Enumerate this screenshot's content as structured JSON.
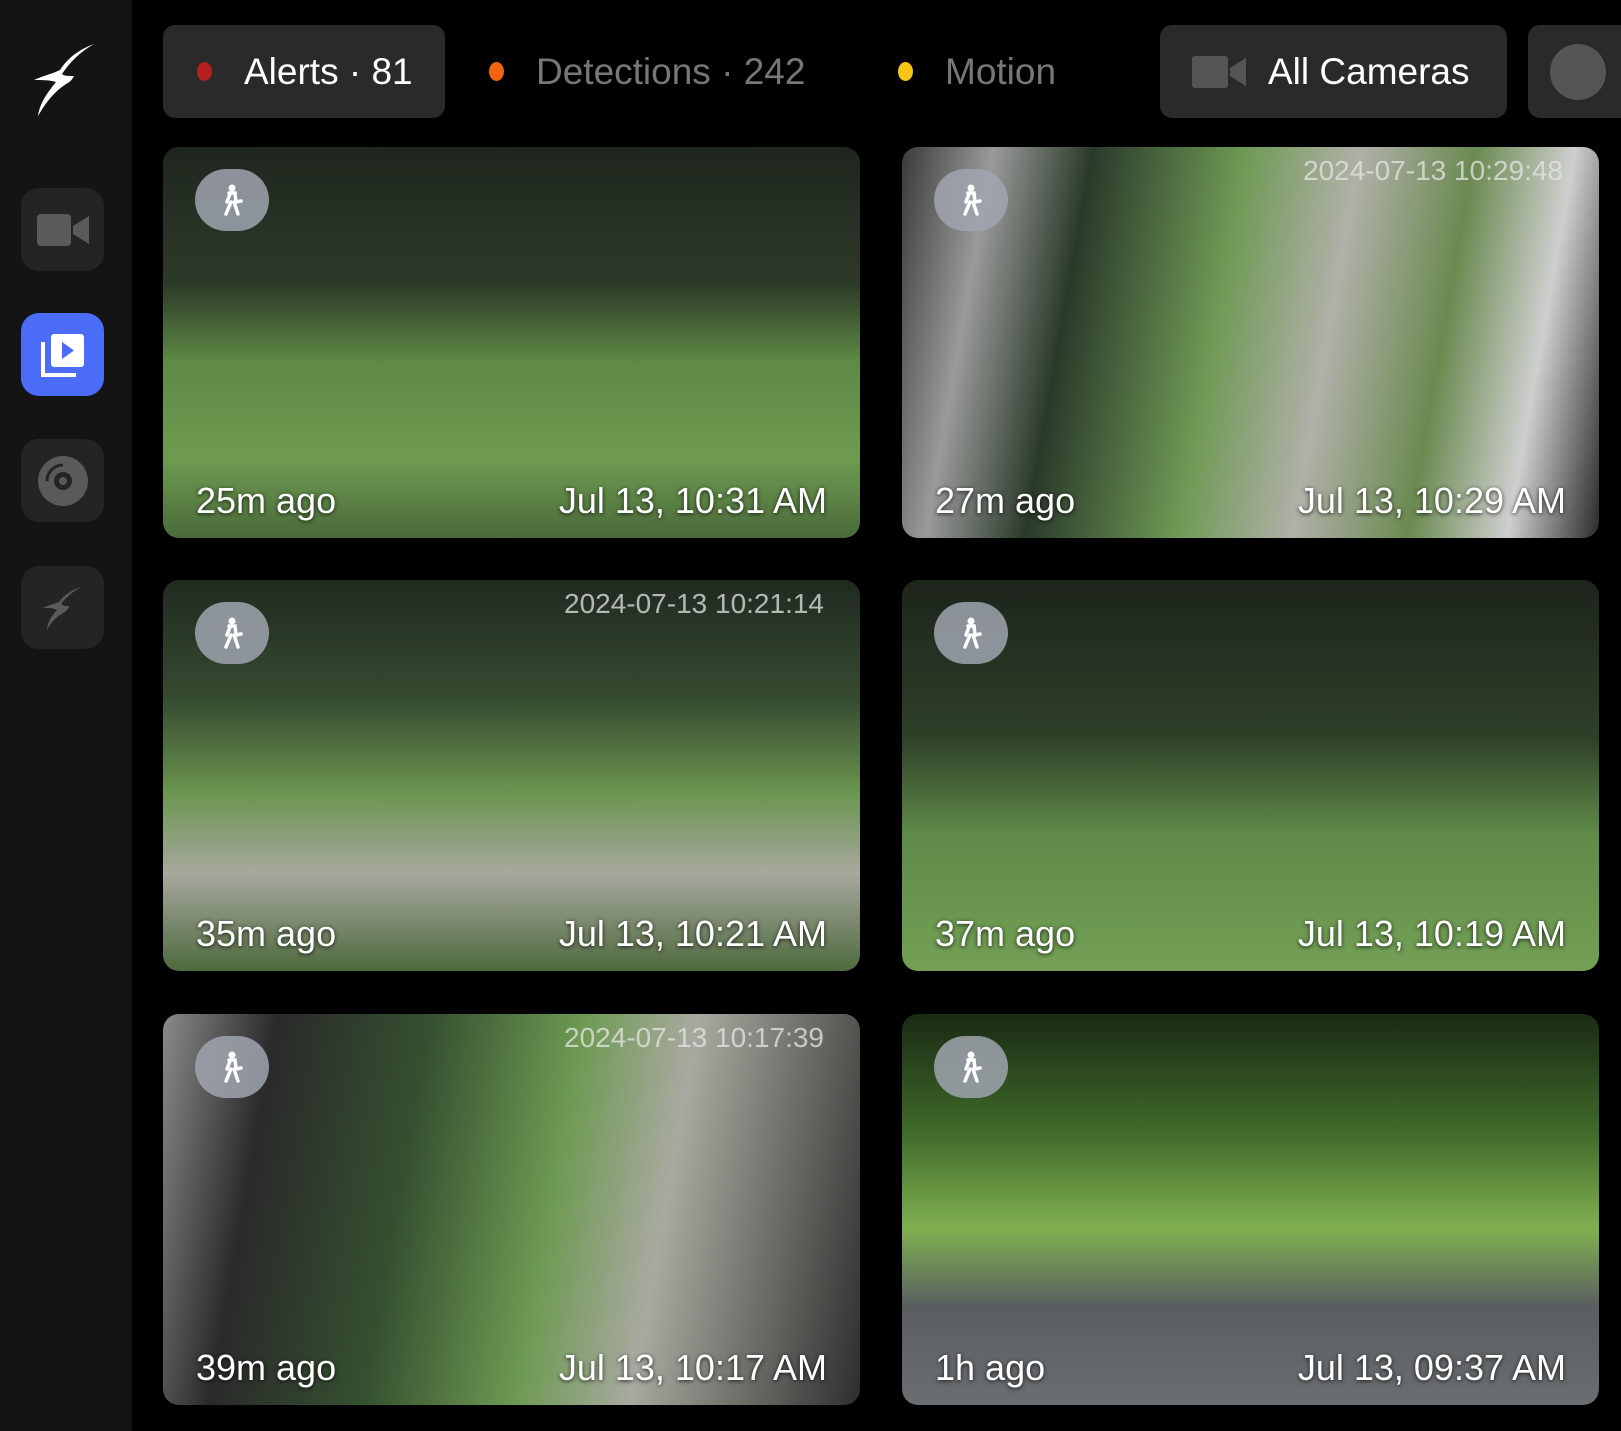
{
  "sidebar": {
    "items": [
      {
        "name": "live",
        "icon": "video-camera-icon"
      },
      {
        "name": "review",
        "icon": "play-stack-icon",
        "active": true
      },
      {
        "name": "export",
        "icon": "disc-icon"
      },
      {
        "name": "frigate",
        "icon": "bird-icon"
      }
    ]
  },
  "filters": {
    "alerts": {
      "label": "Alerts · 81",
      "color": "#b3201e"
    },
    "detections": {
      "label": "Detections · 242",
      "color": "#f0650d"
    },
    "motion": {
      "label": "Motion",
      "color": "#f5c518"
    }
  },
  "cameras": {
    "label": "All Cameras"
  },
  "cards": [
    {
      "ago": "25m ago",
      "time": "Jul 13, 10:31 AM",
      "osd": ""
    },
    {
      "ago": "27m ago",
      "time": "Jul 13, 10:29 AM",
      "osd": "2024-07-13 10:29:48"
    },
    {
      "ago": "35m ago",
      "time": "Jul 13, 10:21 AM",
      "osd": "2024-07-13 10:21:14"
    },
    {
      "ago": "37m ago",
      "time": "Jul 13, 10:19 AM",
      "osd": ""
    },
    {
      "ago": "39m ago",
      "time": "Jul 13, 10:17 AM",
      "osd": "2024-07-13 10:17:39"
    },
    {
      "ago": "1h ago",
      "time": "Jul 13, 09:37 AM",
      "osd": ""
    }
  ]
}
